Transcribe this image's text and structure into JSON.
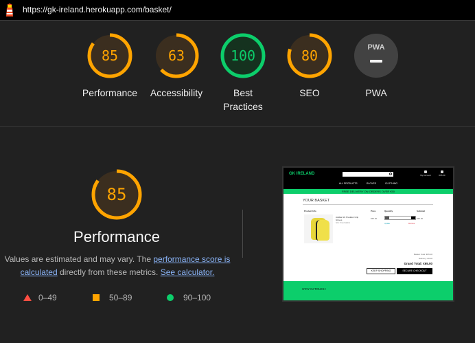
{
  "header": {
    "url": "https://gk-ireland.herokuapp.com/basket/"
  },
  "gauges": [
    {
      "score": "85",
      "label": "Performance",
      "color": "#ffa400",
      "fraction": 0.85
    },
    {
      "score": "63",
      "label": "Accessibility",
      "color": "#ffa400",
      "fraction": 0.63
    },
    {
      "score": "100",
      "label_line1": "Best",
      "label_line2": "Practices",
      "color": "#0cce6b",
      "fraction": 1.0
    },
    {
      "score": "80",
      "label": "SEO",
      "color": "#ffa400",
      "fraction": 0.8
    },
    {
      "badge": "PWA",
      "label": "PWA",
      "color": "#9e9e9e"
    }
  ],
  "performance": {
    "score": "85",
    "fraction": 0.85,
    "color": "#ffa400",
    "title": "Performance",
    "desc_prefix": "Values are estimated and may vary. The ",
    "desc_link1": "performance score is calculated",
    "desc_mid": " directly from these metrics. ",
    "desc_link2": "See calculator."
  },
  "legend": [
    {
      "range": "0–49",
      "shape": "triangle",
      "color": "#ff4e42"
    },
    {
      "range": "50–89",
      "shape": "square",
      "color": "#ffa400"
    },
    {
      "range": "90–100",
      "shape": "circle",
      "color": "#0cce6b"
    }
  ],
  "screenshot": {
    "brand": "GK IRELAND",
    "account": "My Account",
    "bag": "€65.00",
    "menu": [
      "ALL PRODUCTS",
      "GLOVES",
      "CLOTHING"
    ],
    "banner": "FREE DELIVERY ON ORDERS OVER €50",
    "title": "YOUR BASKET",
    "th_product": "Product Info",
    "th_price": "Price",
    "th_qty": "Quantity",
    "th_subtotal": "Subtotal",
    "item_name": "Adidas GK Predator Grip Gloves",
    "item_sku": "SKU: PGLOVE001",
    "item_price": "€65.00",
    "item_update": "Update",
    "item_remove": "Remove",
    "item_subtotal": "€65.00",
    "basket_total": "Basket Total: €65.00",
    "delivery": "Delivery: €0.00",
    "grand_total": "Grand Total: €65.00",
    "keep_shopping": "KEEP SHOPPING",
    "secure_checkout": "SECURE CHECKOUT",
    "stay_in_touch": "STAY IN TOUCH:"
  }
}
